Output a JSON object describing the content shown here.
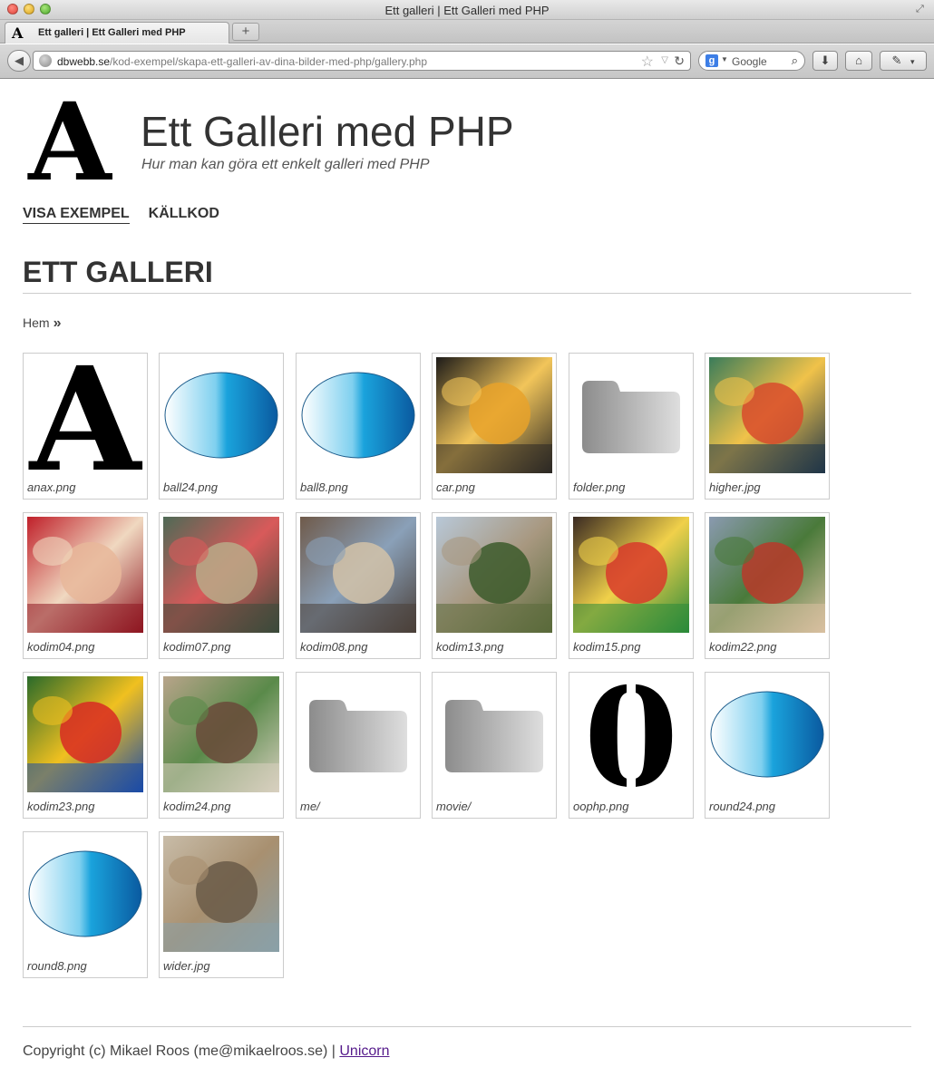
{
  "window": {
    "title": "Ett galleri | Ett Galleri med PHP"
  },
  "tabs": [
    {
      "label": "Ett galleri | Ett Galleri med PHP",
      "favicon": "A",
      "active": true
    }
  ],
  "new_tab_label": "+",
  "address_bar": {
    "host": "dbwebb.se",
    "path": "/kod-exempel/skapa-ett-galleri-av-dina-bilder-med-php/gallery.php"
  },
  "search_bar": {
    "placeholder": "Google",
    "engine_icon": "g"
  },
  "icons": {
    "back": "back-arrow-icon",
    "globe": "globe-icon",
    "star": "bookmark-star-icon",
    "reload": "reload-icon",
    "search": "magnifier-icon",
    "download": "download-arrow-icon",
    "home": "home-icon",
    "tools": "eyedropper-icon"
  },
  "site": {
    "logo_letter": "A",
    "title": "Ett Galleri med PHP",
    "slogan": "Hur man kan göra ett enkelt galleri med PHP"
  },
  "nav": [
    {
      "label": "Visa exempel",
      "selected": true
    },
    {
      "label": "Källkod",
      "selected": false
    }
  ],
  "page": {
    "heading": "Ett galleri"
  },
  "breadcrumb": {
    "home": "Hem",
    "separator": "»"
  },
  "gallery": [
    {
      "caption": "anax.png",
      "kind": "letter",
      "glyph": "A"
    },
    {
      "caption": "ball24.png",
      "kind": "ball"
    },
    {
      "caption": "ball8.png",
      "kind": "ball"
    },
    {
      "caption": "car.png",
      "kind": "photo",
      "colors": [
        "#1d1b19",
        "#e8a22a",
        "#f2c55a",
        "#2b2824"
      ]
    },
    {
      "caption": "folder.png",
      "kind": "folder"
    },
    {
      "caption": "higher.jpg",
      "kind": "photo",
      "colors": [
        "#3a7c5a",
        "#d84b2c",
        "#f0c24a",
        "#1f3548"
      ]
    },
    {
      "caption": "kodim04.png",
      "kind": "photo",
      "colors": [
        "#c0202a",
        "#e8b79a",
        "#f0d8c0",
        "#8e1520"
      ]
    },
    {
      "caption": "kodim07.png",
      "kind": "photo",
      "colors": [
        "#4e6a56",
        "#b8aa88",
        "#d85a5a",
        "#3a4a3a"
      ]
    },
    {
      "caption": "kodim08.png",
      "kind": "photo",
      "colors": [
        "#6f5a4a",
        "#d2c2a8",
        "#8aa0b8",
        "#4a3f38"
      ]
    },
    {
      "caption": "kodim13.png",
      "kind": "photo",
      "colors": [
        "#b8c8d8",
        "#3c5a2c",
        "#a89880",
        "#5a6a3a"
      ]
    },
    {
      "caption": "kodim15.png",
      "kind": "photo",
      "colors": [
        "#3a2a22",
        "#d83a2a",
        "#f0d04a",
        "#2a8a3a"
      ]
    },
    {
      "caption": "kodim22.png",
      "kind": "photo",
      "colors": [
        "#8a9ab0",
        "#b83a2a",
        "#4a7a3a",
        "#d8c0a0"
      ]
    },
    {
      "caption": "kodim23.png",
      "kind": "photo",
      "colors": [
        "#2a6a2a",
        "#d82a22",
        "#f0c020",
        "#1a4aa8"
      ]
    },
    {
      "caption": "kodim24.png",
      "kind": "photo",
      "colors": [
        "#b8a48a",
        "#6a4a3a",
        "#5a8a4a",
        "#d8d0c0"
      ]
    },
    {
      "caption": "me/",
      "kind": "folder"
    },
    {
      "caption": "movie/",
      "kind": "folder"
    },
    {
      "caption": "oophp.png",
      "kind": "letter",
      "glyph": "0"
    },
    {
      "caption": "round24.png",
      "kind": "ball"
    },
    {
      "caption": "round8.png",
      "kind": "ball"
    },
    {
      "caption": "wider.jpg",
      "kind": "photo",
      "colors": [
        "#c8bca8",
        "#6a5a48",
        "#a89070",
        "#8aa0a8"
      ]
    }
  ],
  "footer": {
    "text": "Copyright (c) Mikael Roos (me@mikaelroos.se) | ",
    "link_label": "Unicorn"
  }
}
